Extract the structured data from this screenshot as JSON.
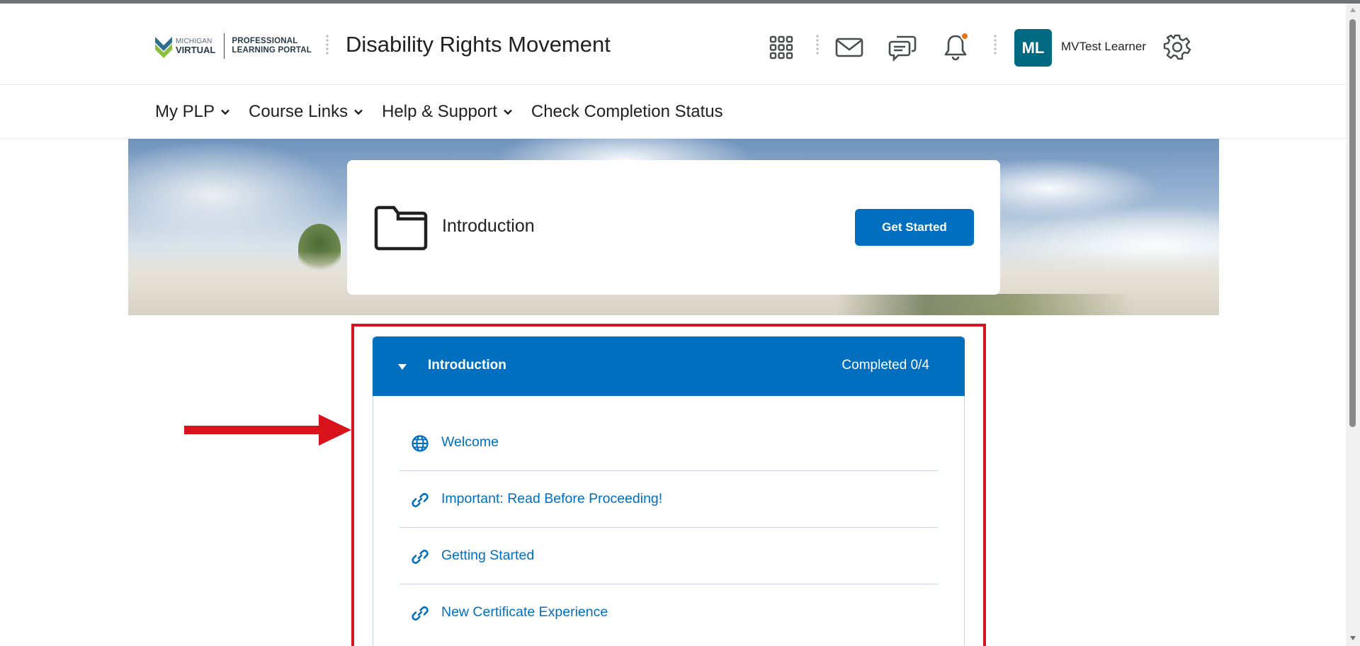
{
  "header": {
    "logo": {
      "brand_line1": "MICHIGAN",
      "brand_line2": "VIRTUAL",
      "portal_line1": "PROFESSIONAL",
      "portal_line2": "LEARNING PORTAL"
    },
    "course_title": "Disability Rights Movement",
    "icons": [
      "grid-icon",
      "mail-icon",
      "chat-icon",
      "bell-icon",
      "gear-icon"
    ],
    "notification_color": "#e87511",
    "user": {
      "initials": "ML",
      "name": "MVTest Learner",
      "avatar_color": "#006a83"
    }
  },
  "nav": {
    "items": [
      {
        "label": "My PLP",
        "has_dropdown": true
      },
      {
        "label": "Course Links",
        "has_dropdown": true
      },
      {
        "label": "Help & Support",
        "has_dropdown": true
      },
      {
        "label": "Check Completion Status",
        "has_dropdown": false
      }
    ]
  },
  "intro_card": {
    "title": "Introduction",
    "button_label": "Get Started"
  },
  "module": {
    "title": "Introduction",
    "progress": "Completed 0/4",
    "topics": [
      {
        "label": "Welcome",
        "icon": "globe-icon"
      },
      {
        "label": "Important: Read Before Proceeding!",
        "icon": "link-icon"
      },
      {
        "label": "Getting Started",
        "icon": "link-icon"
      },
      {
        "label": "New Certificate Experience",
        "icon": "link-icon"
      }
    ]
  },
  "colors": {
    "accent": "#006fbf",
    "highlight": "#d9131c"
  }
}
